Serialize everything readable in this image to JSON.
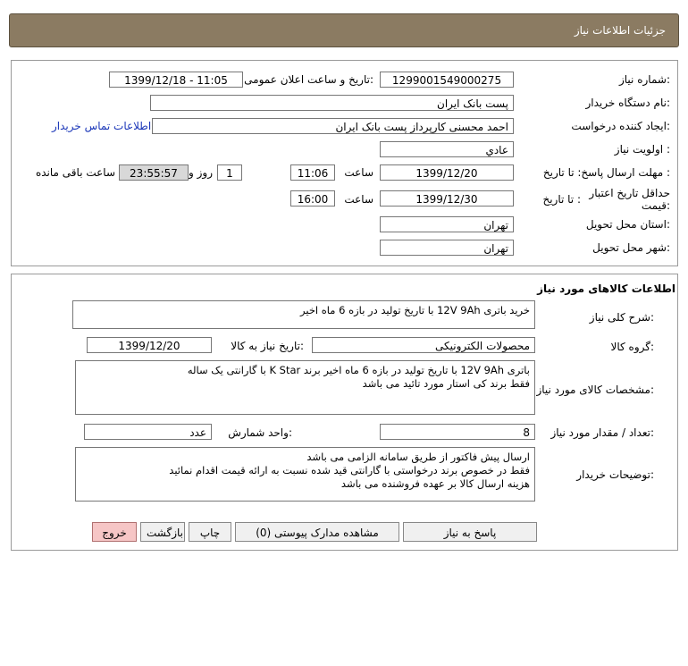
{
  "header": {
    "title": "جزئیات اطلاعات نیاز"
  },
  "info": {
    "need_number": {
      "label": "شماره نیاز:",
      "value": "1299001549000275"
    },
    "announce": {
      "label": "تاریخ و ساعت اعلان عمومی:",
      "value": "1399/12/18 - 11:05"
    },
    "buyer_org": {
      "label": "نام دستگاه خریدار:",
      "value": "پست بانک ایران"
    },
    "requester": {
      "label": "ایجاد کننده درخواست:",
      "value": "احمد  محسنی کارپرداز پست بانک ایران"
    },
    "contact_link": "اطلاعات تماس خریدار",
    "priority": {
      "label": "اولویت نیاز :",
      "value": "عادي"
    },
    "deadline": {
      "label": "مهلت ارسال پاسخ: تا تاریخ :",
      "date": "1399/12/20",
      "time_label": "ساعت",
      "time": "11:06",
      "days": "1",
      "days_label": "روز و",
      "remaining": "23:55:57",
      "remaining_label": "ساعت باقی مانده"
    },
    "validity": {
      "label_line1": "حداقل تاریخ اعتبار",
      "label_line2": "قیمت:",
      "to_date_label": "تا تاریخ :",
      "date": "1399/12/30",
      "time_label": "ساعت",
      "time": "16:00"
    },
    "province": {
      "label": "استان محل تحویل:",
      "value": "تهران"
    },
    "city": {
      "label": "شهر محل تحویل:",
      "value": "تهران"
    }
  },
  "goods": {
    "title": "اطلاعات کالاهای مورد نیاز",
    "description": {
      "label": "شرح کلی نیاز:",
      "value": "خرید باتری 12V 9Ah با تاریخ تولید در بازه 6 ماه اخیر"
    },
    "group": {
      "label": "گروه کالا:",
      "value": "محصولات الکترونیکی"
    },
    "need_date": {
      "label": "تاریخ نیاز به کالا:",
      "value": "1399/12/20"
    },
    "specs": {
      "label": "مشخصات کالای مورد نیاز:",
      "lines": [
        "باتری 12V 9Ah با تاریخ تولید در بازه 6 ماه اخیر برند K Star  با گارانتی یک ساله",
        "فقط برند کی استار مورد تائید می باشد"
      ]
    },
    "quantity": {
      "label": "تعداد / مقدار مورد نیاز:",
      "value": "8"
    },
    "unit": {
      "label": "واحد شمارش:",
      "value": "عدد"
    },
    "buyer_notes": {
      "label": "توضیحات خریدار:",
      "lines": [
        "ارسال پیش فاکتور از طریق سامانه الزامی می باشد",
        "فقط در خصوص برند درخواستی با گارانتی قید شده نسبت به ارائه قیمت اقدام نمائید",
        "هزینه ارسال کالا بر عهده فروشنده می باشد"
      ]
    }
  },
  "buttons": {
    "reply": "پاسخ به نیاز",
    "attachments": "مشاهده مدارک پیوستی (0)",
    "print": "چاپ",
    "back": "بازگشت",
    "exit": "خروج"
  },
  "colors": {
    "header_bg": "#8b7b62",
    "exit_bg": "#f6c6c6",
    "link": "#1a36b8"
  }
}
